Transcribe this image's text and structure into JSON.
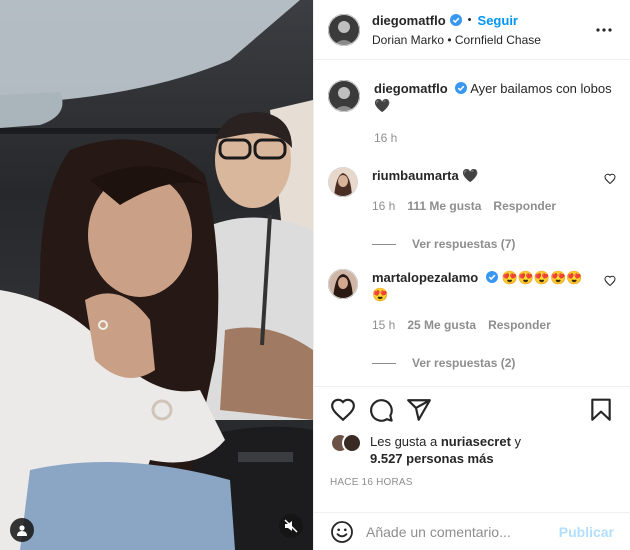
{
  "post": {
    "author": "diegomatflo",
    "follow_label": "Seguir",
    "dot": "•",
    "subtitle": "Dorian Marko • Cornfield Chase",
    "more_icon": "more-horizontal-icon"
  },
  "caption": {
    "username": "diegomatflo",
    "text": "Ayer bailamos con lobos",
    "emoji": "🖤",
    "time": "16 h"
  },
  "comments": [
    {
      "username": "riumbaumarta",
      "text": "🖤",
      "time": "16 h",
      "likes": "111 Me gusta",
      "reply_label": "Responder",
      "view_replies": "Ver respuestas (7)"
    },
    {
      "username": "martalopezalamo",
      "text": "😍😍😍😍😍😍",
      "time": "15 h",
      "likes": "25 Me gusta",
      "reply_label": "Responder",
      "view_replies": "Ver respuestas (2)"
    }
  ],
  "likes": {
    "prefix": "Les gusta a ",
    "user": "nuriasecret",
    "connector": " y",
    "others": "9.527 personas más"
  },
  "timestamp": "HACE 16 HORAS",
  "add_comment": {
    "placeholder": "Añade un comentario...",
    "publish_label": "Publicar"
  },
  "colors": {
    "accent": "#0095f6",
    "publish_disabled": "#b2dffc",
    "verified": "#3897f0",
    "muted": "#8e8e8e"
  }
}
